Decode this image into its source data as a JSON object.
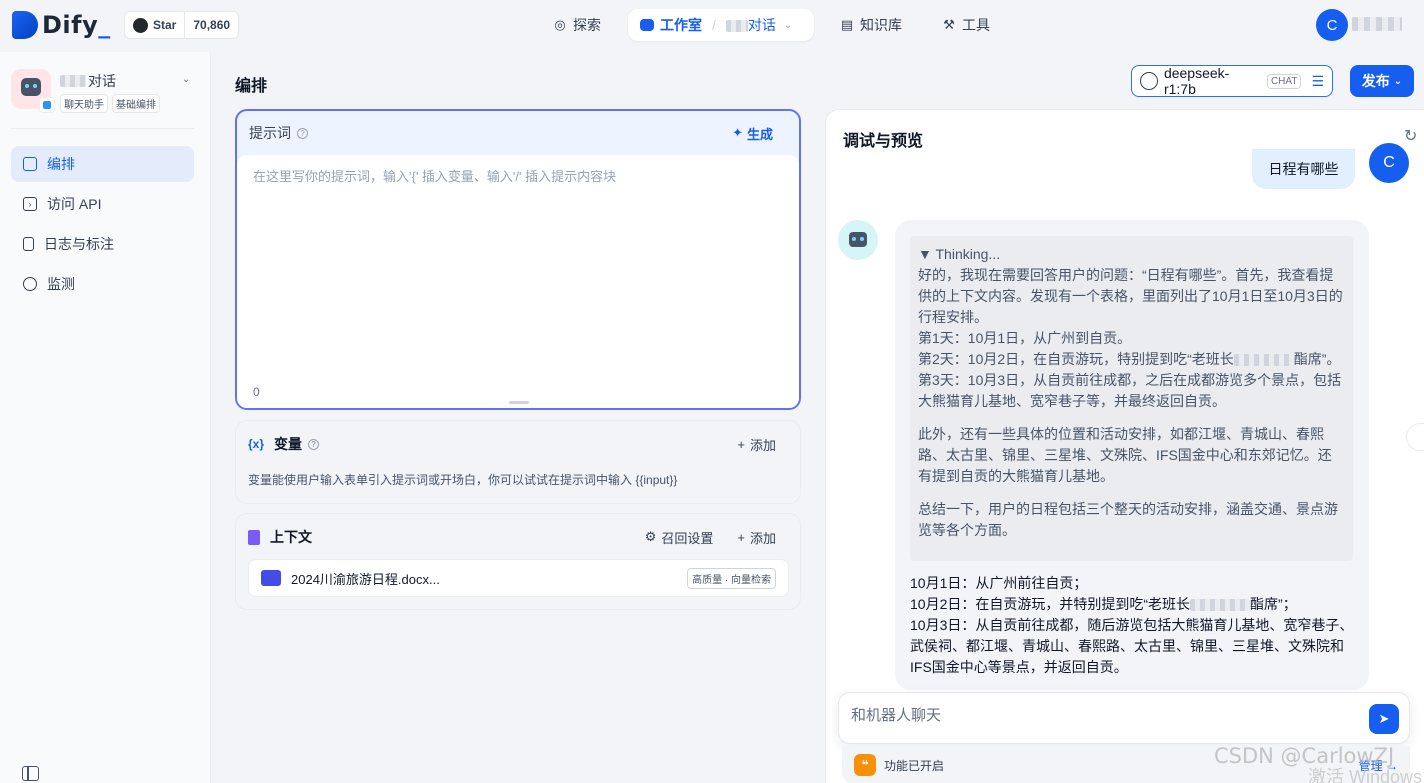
{
  "topbar": {
    "logo_text": "Dify",
    "star_label": "Star",
    "star_count": "70,860",
    "nav": {
      "explore": "探索",
      "studio": "工作室",
      "app_name": "对话",
      "knowledge": "知识库",
      "tools": "工具"
    },
    "user_initial": "C"
  },
  "sidebar": {
    "app_name": "对话",
    "tags": [
      "聊天助手",
      "基础编排"
    ],
    "items": [
      {
        "label": "编排",
        "icon": "layout-icon",
        "active": true
      },
      {
        "label": "访问 API",
        "icon": "terminal-icon",
        "active": false
      },
      {
        "label": "日志与标注",
        "icon": "file-list-icon",
        "active": false
      },
      {
        "label": "监测",
        "icon": "dashboard-icon",
        "active": false
      }
    ]
  },
  "main": {
    "title": "编排",
    "model": {
      "name": "deepseek-r1:7b",
      "mode_tag": "CHAT"
    },
    "publish_label": "发布",
    "prompt": {
      "title": "提示词",
      "generate_label": "生成",
      "placeholder": "在这里写你的提示词，输入'{' 插入变量、输入'/' 插入提示内容块",
      "char_count": "0"
    },
    "variables": {
      "title": "变量",
      "add_label": "添加",
      "description": "变量能使用户输入表单引入提示词或开场白，你可以试试在提示词中输入 {{input}}"
    },
    "context": {
      "title": "上下文",
      "recall_label": "召回设置",
      "add_label": "添加",
      "file_name": "2024川渝旅游日程.docx...",
      "file_tag": "高质量 · 向量检索"
    }
  },
  "debug": {
    "title": "调试与预览",
    "user_message": "日程有哪些",
    "user_initial": "C",
    "thinking_label": "▼ Thinking...",
    "thinking_paragraphs": [
      [
        "好的，我现在需要回答用户的问题：“日程有哪些”。首先，我查看提供的上下文内容。发现有一个表格，里面列出了10月1日至10月3日的行程安排。",
        "第1天：10月1日，从广州到自贡。",
        "第2天：10月2日，在自贡游玩，特别提到吃“老班长",
        "第3天：10月3日，从自贡前往成都，之后在成都游览多个景点，包括大熊猫育儿基地、宽窄巷子等，并最终返回自贡。"
      ],
      [
        "此外，还有一些具体的位置和活动安排，如都江堰、青城山、春熙路、太古里、锦里、三星堆、文殊院、IFS国金中心和东郊记忆。还有提到自贡的大熊猫育儿基地。"
      ],
      [
        "总结一下，用户的日程包括三个整天的活动安排，涵盖交通、景点游览等各个方面。"
      ]
    ],
    "thinking_day2_tail": "酯席”。",
    "answer_lines": [
      "10月1日：从广州前往自贡；",
      "10月2日：在自贡游玩，并特别提到吃“老班长",
      "10月3日：从自贡前往成都，随后游览包括大熊猫育儿基地、宽窄巷子、武侯祠、都江堰、青城山、春熙路、太古里、锦里、三星堆、文殊院和IFS国金中心等景点，并返回自贡。"
    ],
    "answer_day2_tail": "酯席”；",
    "input_placeholder": "和机器人聊天",
    "feature_label": "功能已开启",
    "feature_manage": "管理"
  },
  "watermark": {
    "csdn": "CSDN @CarlowZJ",
    "windows": "激活 Windows"
  }
}
